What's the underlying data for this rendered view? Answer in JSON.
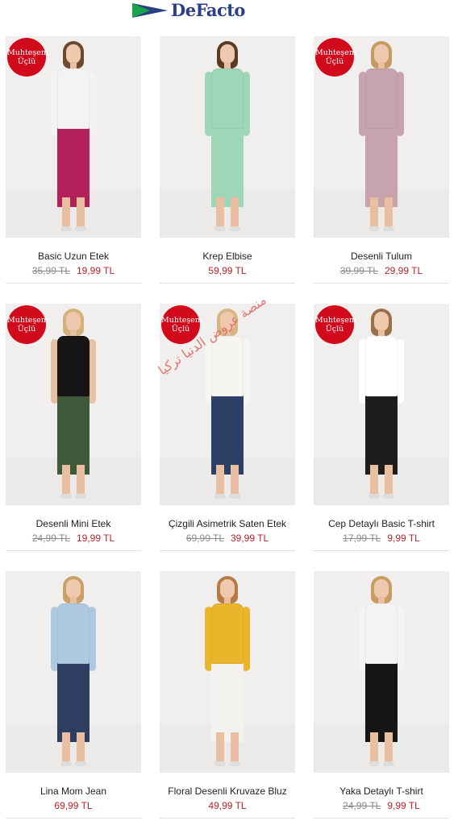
{
  "brand": {
    "name": "DeFacto"
  },
  "badge": {
    "line1": "Muhteşem",
    "line2": "Üçlü"
  },
  "watermark": "منصة عروض الدنيا تركيا",
  "products": [
    {
      "name": "Basic Uzun Etek",
      "old_price": "35,99 TL",
      "price": "19,99 TL",
      "badge": true,
      "top_color": "#f3f3f1",
      "bottom_color": "#b3205a",
      "hair": "#6b4a30"
    },
    {
      "name": "Krep Elbise",
      "old_price": "",
      "price": "59,99 TL",
      "badge": false,
      "top_color": "#9ed6b8",
      "bottom_color": "#9ed6b8",
      "hair": "#5a3b24"
    },
    {
      "name": "Desenli Tulum",
      "old_price": "39,99 TL",
      "price": "29,99 TL",
      "badge": true,
      "top_color": "#c7a3ad",
      "bottom_color": "#c7a3ad",
      "hair": "#c69a62"
    },
    {
      "name": "Desenli Mini Etek",
      "old_price": "24,99 TL",
      "price": "19,99 TL",
      "badge": true,
      "top_color": "#151515",
      "bottom_color": "#3f5a3a",
      "hair": "#d4b07a"
    },
    {
      "name": "Çizgili Asimetrik Saten Etek",
      "old_price": "69,99 TL",
      "price": "39,99 TL",
      "badge": true,
      "top_color": "#f7f5f2",
      "bottom_color": "#2e3f66",
      "hair": "#d7b57e"
    },
    {
      "name": "Cep Detaylı Basic T-shirt",
      "old_price": "17,99 TL",
      "price": "9,99 TL",
      "badge": true,
      "top_color": "#ffffff",
      "bottom_color": "#1d1d1d",
      "hair": "#9b7048"
    },
    {
      "name": "Lina Mom Jean",
      "old_price": "",
      "price": "69,99 TL",
      "badge": false,
      "top_color": "#aec8e0",
      "bottom_color": "#2d3e60",
      "hair": "#c9a06a"
    },
    {
      "name": "Floral Desenli Kruvaze Bluz",
      "old_price": "",
      "price": "49,99 TL",
      "badge": false,
      "top_color": "#e9b52a",
      "bottom_color": "#f4f2ee",
      "hair": "#b57a45"
    },
    {
      "name": "Yaka Detaylı T-shirt",
      "old_price": "24,99 TL",
      "price": "9,99 TL",
      "badge": false,
      "top_color": "#f4f4f4",
      "bottom_color": "#151515",
      "hair": "#c89c62"
    }
  ]
}
